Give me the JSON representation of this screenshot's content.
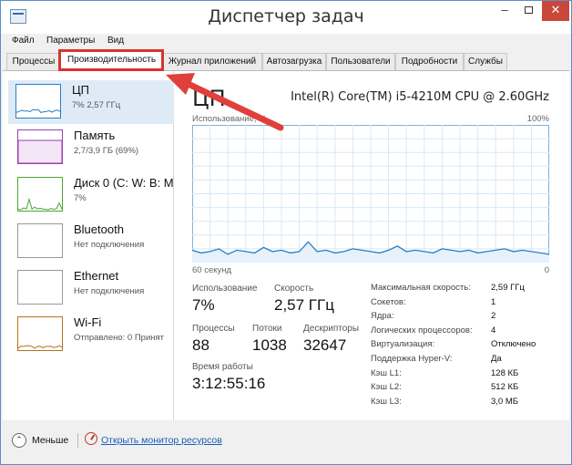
{
  "window": {
    "title": "Диспетчер задач",
    "min_glyph": "–",
    "close_glyph": "✕"
  },
  "menu": [
    "Файл",
    "Параметры",
    "Вид"
  ],
  "tabs": [
    "Процессы",
    "Производительность",
    "Журнал приложений",
    "Автозагрузка",
    "Пользователи",
    "Подробности",
    "Службы"
  ],
  "active_tab": "Производительность",
  "sidebar": {
    "items": [
      {
        "name": "ЦП",
        "sub": "7% 2,57 ГГц",
        "color": "#2a7fc4"
      },
      {
        "name": "Память",
        "sub": "2,7/3,9 ГБ (69%)",
        "color": "#9b3fb0"
      },
      {
        "name": "Диск 0 (C: W: B: M",
        "sub": "7%",
        "color": "#4aa637"
      },
      {
        "name": "Bluetooth",
        "sub": "Нет подключения",
        "color": "#999999"
      },
      {
        "name": "Ethernet",
        "sub": "Нет подключения",
        "color": "#999999"
      },
      {
        "name": "Wi-Fi",
        "sub": "Отправлено: 0 Принят",
        "color": "#b5731e"
      }
    ]
  },
  "main": {
    "title": "ЦП",
    "cpu_model": "Intel(R) Core(TM) i5-4210M CPU @ 2.60GHz",
    "usage_label": "Использование, %",
    "max_pct": "100%",
    "time_left": "60 секунд",
    "time_right": "0",
    "stats": {
      "usage_label": "Использование",
      "usage_value": "7%",
      "speed_label": "Скорость",
      "speed_value": "2,57 ГГц",
      "proc_label": "Процессы",
      "proc_value": "88",
      "threads_label": "Потоки",
      "threads_value": "1038",
      "handles_label": "Дескрипторы",
      "handles_value": "32647",
      "uptime_label": "Время работы",
      "uptime_value": "3:12:55:16"
    },
    "specs": [
      {
        "label": "Максимальная скорость:",
        "value": "2,59 ГГц"
      },
      {
        "label": "Сокетов:",
        "value": "1"
      },
      {
        "label": "Ядра:",
        "value": "2"
      },
      {
        "label": "Логических процессоров:",
        "value": "4"
      },
      {
        "label": "Виртуализация:",
        "value": "Отключено"
      },
      {
        "label": "Поддержка Hyper-V:",
        "value": "Да"
      },
      {
        "label": "Кэш L1:",
        "value": "128 КБ"
      },
      {
        "label": "Кэш L2:",
        "value": "512 КБ"
      },
      {
        "label": "Кэш L3:",
        "value": "3,0 МБ"
      }
    ],
    "graph_series": [
      9,
      7,
      8,
      10,
      6,
      9,
      8,
      7,
      11,
      8,
      9,
      7,
      8,
      15,
      8,
      9,
      7,
      8,
      10,
      9,
      8,
      7,
      9,
      12,
      8,
      9,
      8,
      7,
      10,
      9,
      8,
      9,
      7,
      8,
      9,
      10,
      8,
      9,
      8,
      7,
      6
    ]
  },
  "footer": {
    "less_label": "Меньше",
    "less_glyph": "⌃",
    "monitor_link": "Открыть монитор ресурсов"
  },
  "colors": {
    "accent": "#2a7fc4",
    "highlight": "#d9332f"
  }
}
